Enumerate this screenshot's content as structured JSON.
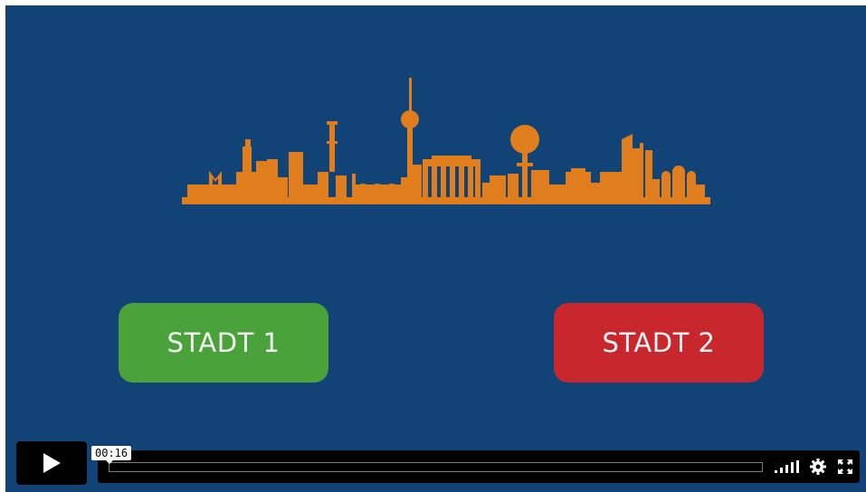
{
  "video": {
    "choices": [
      {
        "label": "STADT 1",
        "color": "#4aa23a"
      },
      {
        "label": "STADT 2",
        "color": "#c8272e"
      }
    ],
    "background_color": "#114377",
    "skyline_color": "#e07d1c"
  },
  "player": {
    "current_time": "00:16",
    "progress": 0.0,
    "icons": [
      "play-icon",
      "volume-bars-icon",
      "settings-gear-icon",
      "fullscreen-icon"
    ]
  }
}
